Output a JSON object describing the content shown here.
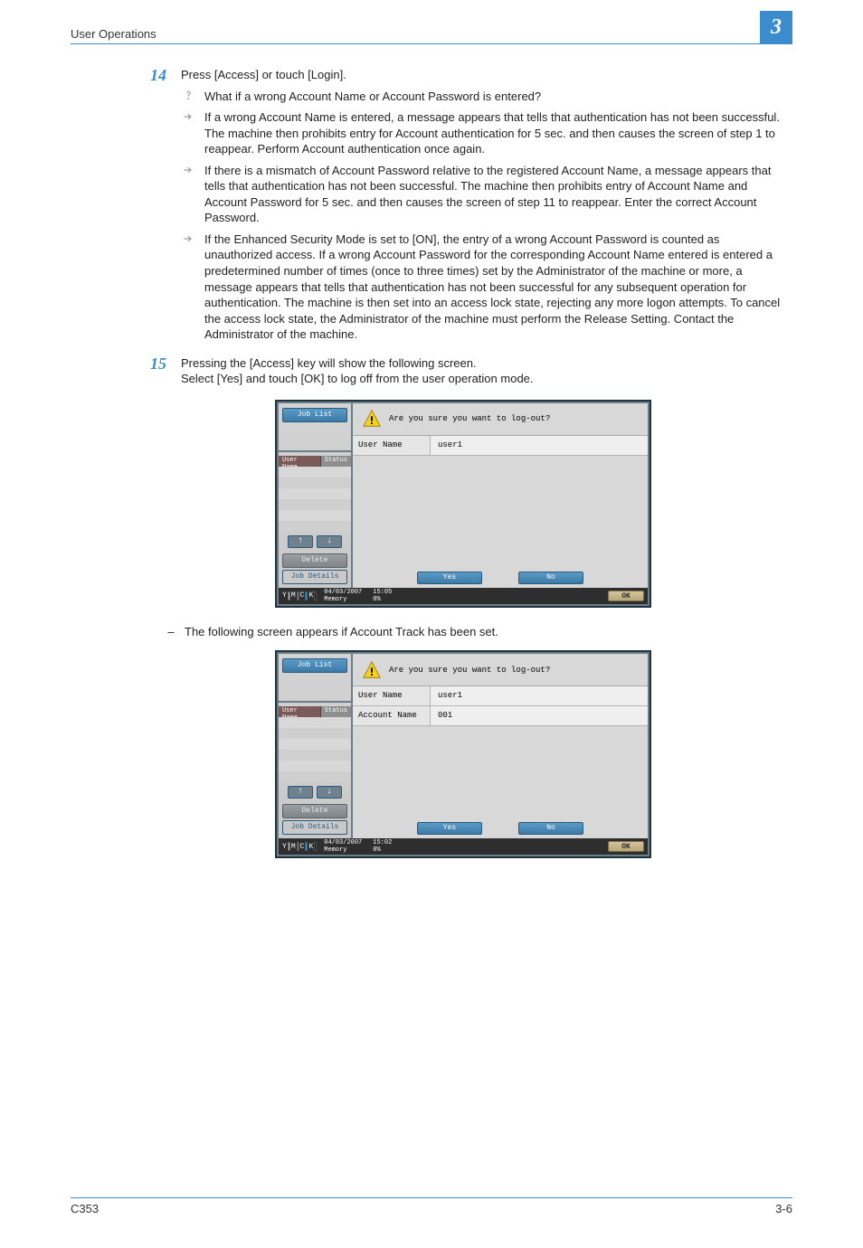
{
  "header": {
    "title": "User Operations",
    "chapter": "3"
  },
  "steps": {
    "s14": {
      "num": "14",
      "text": "Press [Access] or touch [Login].",
      "q": "What if a wrong Account Name or Account Password is entered?",
      "a1": "If a wrong Account Name is entered, a message appears that tells that authentication has not been successful. The machine then prohibits entry for Account authentication for 5 sec. and then causes the screen of step 1 to reappear. Perform Account authentication once again.",
      "a2": "If there is a mismatch of Account Password relative to the registered Account Name, a message appears that tells that authentication has not been successful. The machine then prohibits entry of Account Name and Account Password for 5 sec. and then causes the screen of step 11 to reappear. Enter the correct Account Password.",
      "a3": "If the Enhanced Security Mode is set to [ON], the entry of a wrong Account Password is counted as unauthorized access. If a wrong Account Password for the corresponding Account Name entered is entered a predetermined number of times (once to three times) set by the Administrator of the machine or more, a message appears that tells that authentication has not been successful for any subsequent operation for authentication. The machine is then set into an access lock state, rejecting any more logon attempts. To cancel the access lock state, the Administrator of the machine must perform the Release Setting. Contact the Administrator of the machine."
    },
    "s15": {
      "num": "15",
      "line1": "Pressing the [Access] key will show the following screen.",
      "line2": "Select [Yes] and touch [OK] to log off from the user operation mode.",
      "dash": "The following screen appears if Account Track has been set."
    }
  },
  "panel": {
    "job_list": "Job List",
    "status_user": "User Name",
    "status_status": "Status",
    "delete": "Delete",
    "job_details": "Job Details",
    "msg": "Are you sure you want to log-out?",
    "user_name_label": "User Name",
    "user_name_value": "user1",
    "account_name_label": "Account Name",
    "account_name_value": "001",
    "yes": "Yes",
    "no": "No",
    "ok": "OK",
    "date1": "04/03/2007",
    "time1": "15:05",
    "date2": "04/03/2007",
    "time2": "15:02",
    "memory": "Memory",
    "memory_pct": "0%"
  },
  "footer": {
    "left": "C353",
    "right": "3-6"
  }
}
